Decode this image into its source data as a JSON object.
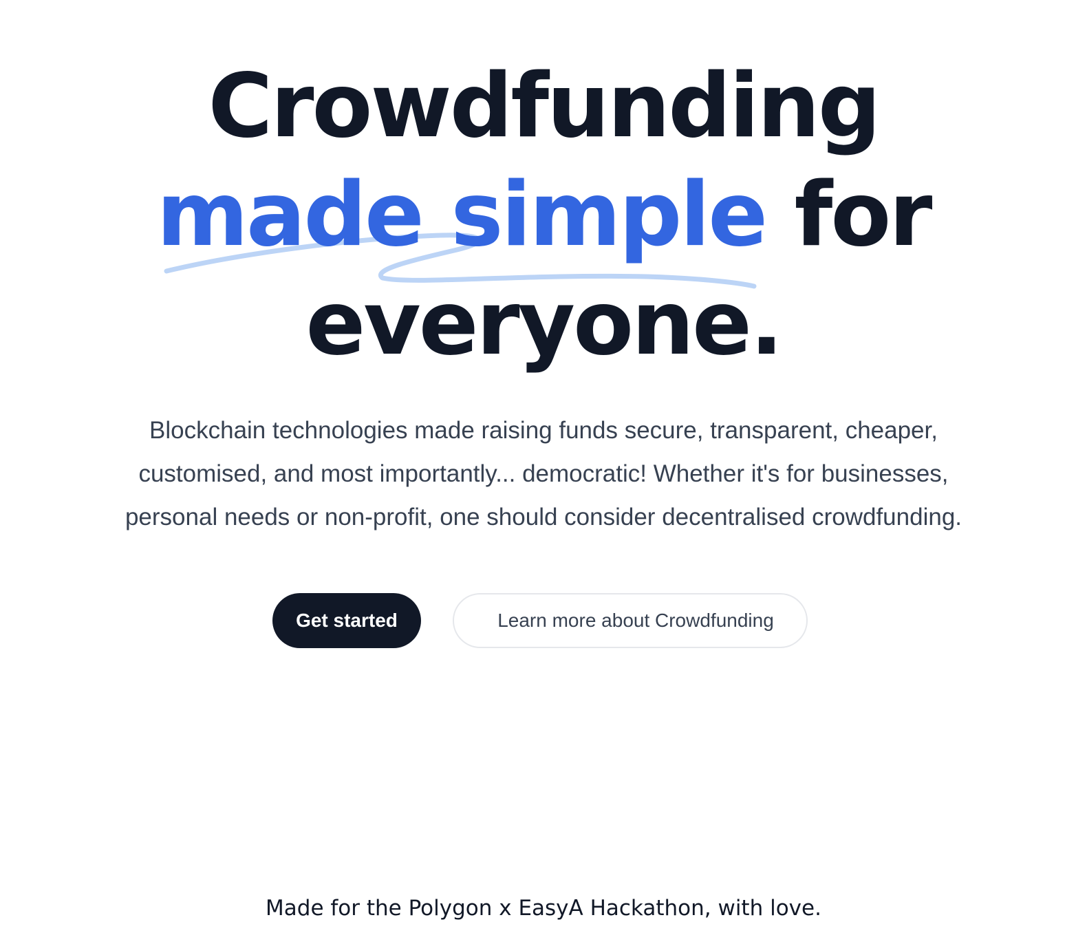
{
  "hero": {
    "headline_line1": "Crowdfunding",
    "headline_accent": "made simple",
    "headline_line2_rest": " for",
    "headline_line3": "everyone.",
    "description": "Blockchain technologies made raising funds secure, transparent, cheaper, customised, and most importantly... democratic! Whether it's for businesses, personal needs or non-profit, one should consider decentralised crowdfunding."
  },
  "actions": {
    "primary_label": "Get started",
    "secondary_label": "Learn more about Crowdfunding"
  },
  "footer": {
    "text": "Made for the Polygon x EasyA Hackathon, with love."
  },
  "colors": {
    "text": "#111827",
    "accent": "#3366e0",
    "squiggle": "#bcd4f6",
    "body_text": "#374151",
    "button_dark": "#111827",
    "button_border": "#e5e7eb"
  }
}
